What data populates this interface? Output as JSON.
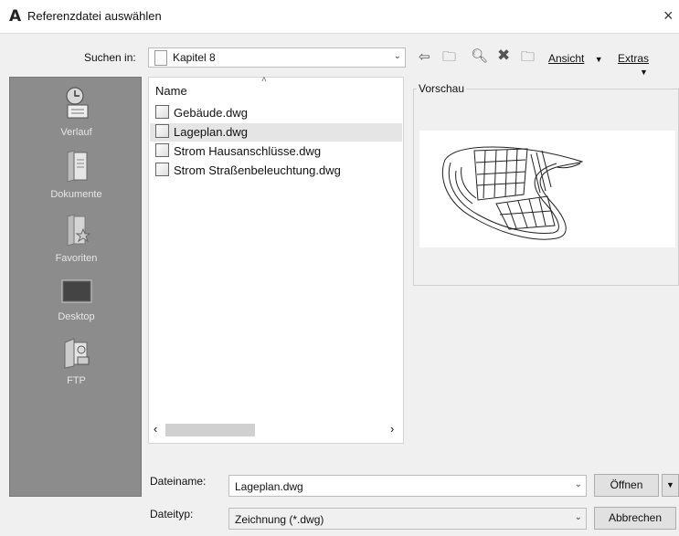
{
  "title": "Referenzdatei auswählen",
  "close_label": "×",
  "look_in": {
    "label": "Suchen in:",
    "value": "Kapitel 8"
  },
  "toolbar": {
    "view_label": "Ansicht",
    "tools_label": "Extras"
  },
  "places": [
    {
      "label": "Verlauf",
      "icon": "history-icon"
    },
    {
      "label": "Dokumente",
      "icon": "documents-icon"
    },
    {
      "label": "Favoriten",
      "icon": "favorites-icon"
    },
    {
      "label": "Desktop",
      "icon": "desktop-icon"
    },
    {
      "label": "FTP",
      "icon": "ftp-icon"
    }
  ],
  "file_list": {
    "column_header": "Name",
    "files": [
      {
        "name": "Gebäude.dwg",
        "selected": false
      },
      {
        "name": "Lageplan.dwg",
        "selected": true
      },
      {
        "name": "Strom Hausanschlüsse.dwg",
        "selected": false
      },
      {
        "name": "Strom Straßenbeleuchtung.dwg",
        "selected": false
      }
    ]
  },
  "preview": {
    "label": "Vorschau"
  },
  "file_name": {
    "label": "Dateiname:",
    "value": "Lageplan.dwg"
  },
  "file_type": {
    "label": "Dateityp:",
    "value": "Zeichnung (*.dwg)"
  },
  "buttons": {
    "open": "Öffnen",
    "cancel": "Abbrechen"
  }
}
